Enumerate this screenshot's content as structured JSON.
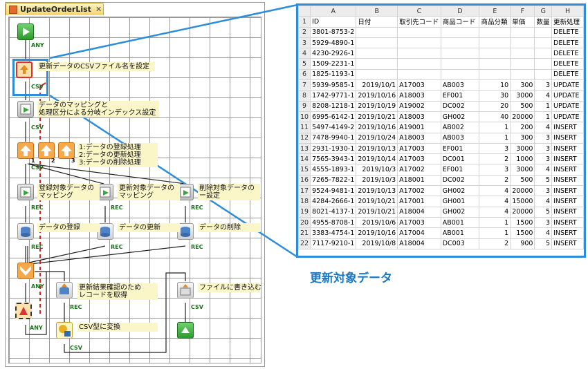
{
  "tab": {
    "title": "UpdateOrderList",
    "close": "✕"
  },
  "steps": {
    "s1": "更新データのCSVファイル名を設定",
    "s2": "データのマッピングと\n処理区分による分岐インデックス設定",
    "s3": "1:データの登録処理\n2:データの更新処理\n3:データの削除処理",
    "s4a": "登録対象データの\nマッピング",
    "s4b": "更新対象データの\nマッピング",
    "s4c": "削除対象データの\nー設定",
    "s5a": "データの登録",
    "s5b": "データの更新",
    "s5c": "データの削除",
    "s6": "更新結果確認のため\nレコードを取得",
    "s7": "CSV型に変換",
    "s8": "ファイルに書き込む"
  },
  "connectors": {
    "any": "ANY",
    "csv": "CSV",
    "rec": "REC",
    "b1": "1",
    "b2": "2",
    "b3": "3"
  },
  "sheet": {
    "columns": [
      "",
      "A",
      "B",
      "C",
      "D",
      "E",
      "F",
      "G",
      "H"
    ],
    "header_row": [
      "1",
      "ID",
      "日付",
      "取引先コード",
      "商品コード",
      "商品分類",
      "単価",
      "数量",
      "更新処理"
    ],
    "rows": [
      [
        "2",
        "3801-8753-2",
        "",
        "",
        "",
        "",
        "",
        "",
        "DELETE"
      ],
      [
        "3",
        "5929-4890-1",
        "",
        "",
        "",
        "",
        "",
        "",
        "DELETE"
      ],
      [
        "4",
        "4230-2926-1",
        "",
        "",
        "",
        "",
        "",
        "",
        "DELETE"
      ],
      [
        "5",
        "1509-2231-1",
        "",
        "",
        "",
        "",
        "",
        "",
        "DELETE"
      ],
      [
        "6",
        "1825-1193-1",
        "",
        "",
        "",
        "",
        "",
        "",
        "DELETE"
      ],
      [
        "7",
        "5939-9585-1",
        "2019/10/1",
        "A17003",
        "AB003",
        "10",
        "300",
        "3",
        "UPDATE"
      ],
      [
        "8",
        "1742-9771-1",
        "2019/10/16",
        "A18003",
        "EF001",
        "30",
        "3000",
        "4",
        "UPDATE"
      ],
      [
        "9",
        "8208-1218-1",
        "2019/10/19",
        "A19002",
        "DC002",
        "20",
        "500",
        "1",
        "UPDATE"
      ],
      [
        "10",
        "6995-6142-1",
        "2019/10/21",
        "A18003",
        "GH002",
        "40",
        "20000",
        "1",
        "UPDATE"
      ],
      [
        "11",
        "5497-4149-2",
        "2019/10/16",
        "A19001",
        "AB002",
        "1",
        "200",
        "4",
        "INSERT"
      ],
      [
        "12",
        "7478-9940-1",
        "2019/10/24",
        "A18003",
        "AB003",
        "1",
        "300",
        "3",
        "INSERT"
      ],
      [
        "13",
        "2931-1930-1",
        "2019/10/13",
        "A17003",
        "EF001",
        "3",
        "3000",
        "3",
        "INSERT"
      ],
      [
        "14",
        "7565-3943-1",
        "2019/10/14",
        "A17003",
        "DC001",
        "2",
        "1000",
        "3",
        "INSERT"
      ],
      [
        "15",
        "4555-1893-1",
        "2019/10/3",
        "A17002",
        "EF001",
        "3",
        "3000",
        "4",
        "INSERT"
      ],
      [
        "16",
        "7265-7822-1",
        "2019/10/3",
        "A18001",
        "DC002",
        "2",
        "500",
        "5",
        "INSERT"
      ],
      [
        "17",
        "9524-9481-1",
        "2019/10/13",
        "A17002",
        "GH002",
        "4",
        "20000",
        "3",
        "INSERT"
      ],
      [
        "18",
        "4284-2666-1",
        "2019/10/21",
        "A17001",
        "GH001",
        "4",
        "15000",
        "4",
        "INSERT"
      ],
      [
        "19",
        "8021-4137-1",
        "2019/10/21",
        "A18004",
        "GH002",
        "4",
        "20000",
        "5",
        "INSERT"
      ],
      [
        "20",
        "4955-8708-1",
        "2019/10/6",
        "A17003",
        "AB001",
        "1",
        "1500",
        "3",
        "INSERT"
      ],
      [
        "21",
        "3383-4754-1",
        "2019/10/16",
        "A17004",
        "AB001",
        "1",
        "1500",
        "4",
        "INSERT"
      ],
      [
        "22",
        "7117-9210-1",
        "2019/10/8",
        "A18004",
        "DC003",
        "2",
        "900",
        "5",
        "INSERT"
      ]
    ]
  },
  "caption": "更新対象データ",
  "colors": {
    "accent": "#2e8ddb",
    "note": "#fbf6c8",
    "start": "#3aa53a",
    "selected": "#e03030"
  }
}
